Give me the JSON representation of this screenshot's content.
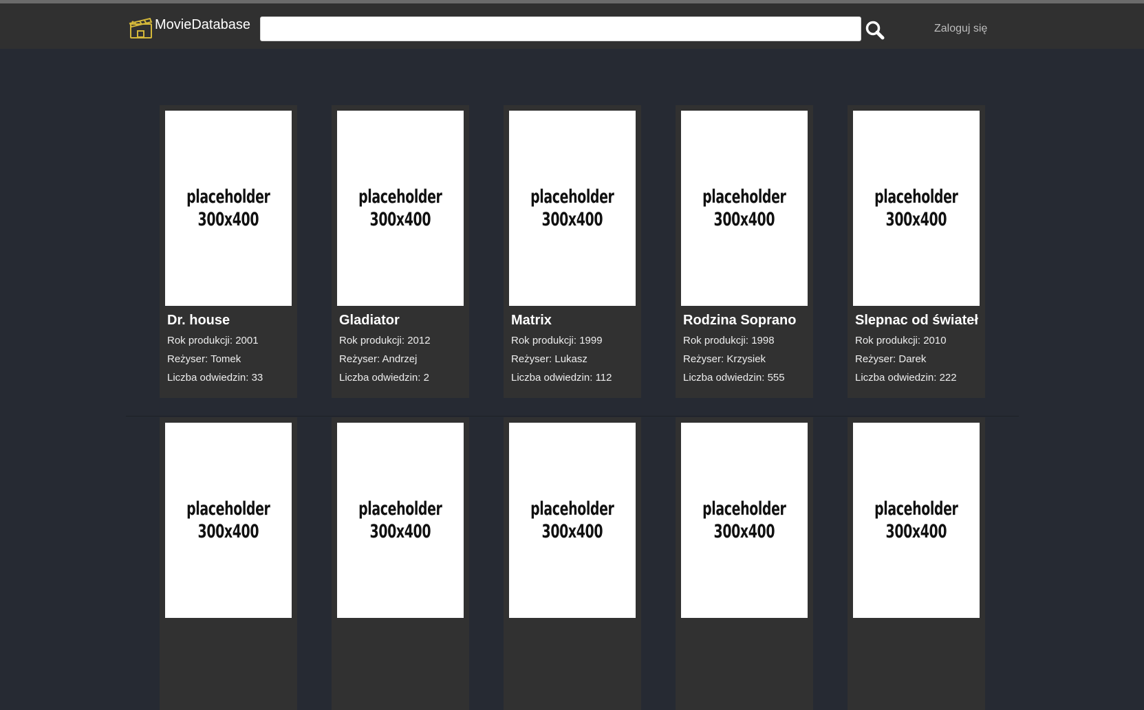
{
  "header": {
    "brand": "MovieDatabase",
    "search_placeholder": "",
    "search_value": "",
    "login_label": "Zaloguj się"
  },
  "labels": {
    "year": "Rok produkcji: ",
    "director": "Reżyser: ",
    "visits": "Liczba odwiedzin: "
  },
  "movies": [
    {
      "title": "Dr. house",
      "year": "2001",
      "director": "Tomek",
      "visits": "33",
      "poster": "placeholder\n300x400"
    },
    {
      "title": "Gladiator",
      "year": "2012",
      "director": "Andrzej",
      "visits": "2",
      "poster": "placeholder\n300x400"
    },
    {
      "title": "Matrix",
      "year": "1999",
      "director": "Lukasz",
      "visits": "112",
      "poster": "placeholder\n300x400"
    },
    {
      "title": "Rodzina Soprano",
      "year": "1998",
      "director": "Krzysiek",
      "visits": "555",
      "poster": "placeholder\n300x400"
    },
    {
      "title": "Slepnac od świateł",
      "year": "2010",
      "director": "Darek",
      "visits": "222",
      "poster": "placeholder\n300x400"
    }
  ],
  "movies_row2": [
    {
      "poster": "placeholder\n300x400"
    },
    {
      "poster": "placeholder\n300x400"
    },
    {
      "poster": "placeholder\n300x400"
    },
    {
      "poster": "placeholder\n300x400"
    },
    {
      "poster": "placeholder\n300x400"
    }
  ],
  "colors": {
    "background": "#262a33",
    "navbar": "#303030",
    "card": "#313131",
    "logo": "#d4b83a"
  }
}
